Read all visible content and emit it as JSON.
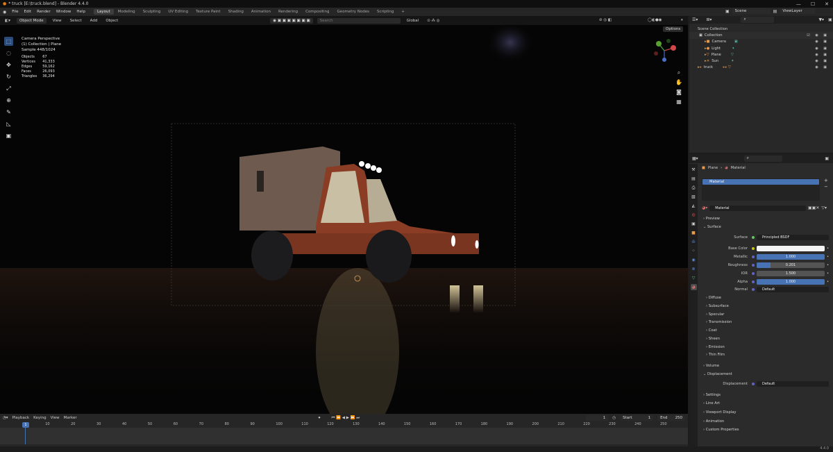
{
  "window": {
    "title": "* truck [E:\\truck.blend] - Blender 4.4.0",
    "controls": [
      "—",
      "☐",
      "✕"
    ]
  },
  "menu": [
    "File",
    "Edit",
    "Render",
    "Window",
    "Help"
  ],
  "workspaces": [
    "Layout",
    "Modeling",
    "Sculpting",
    "UV Editing",
    "Texture Paint",
    "Shading",
    "Animation",
    "Rendering",
    "Compositing",
    "Geometry Nodes",
    "Scripting",
    "+"
  ],
  "scene": {
    "scene_name": "Scene",
    "view_layer": "ViewLayer"
  },
  "viewport_header": {
    "mode": "Object Mode",
    "menus": [
      "View",
      "Select",
      "Add",
      "Object"
    ],
    "transform": "Global",
    "search_placeholder": "Search",
    "options": "Options"
  },
  "viewport_info": {
    "line1": "Camera Perspective",
    "line2": "(1) Collection | Plane",
    "line3": "Sample 448/1024",
    "stats": [
      {
        "label": "Objects",
        "value": "67"
      },
      {
        "label": "Vertices",
        "value": "41,333"
      },
      {
        "label": "Edges",
        "value": "59,162"
      },
      {
        "label": "Faces",
        "value": "26,093"
      },
      {
        "label": "Triangles",
        "value": "36,294"
      }
    ]
  },
  "outliner": {
    "search_placeholder": "",
    "items": [
      {
        "label": "Scene Collection",
        "indent": 0,
        "icon": "collection-icon"
      },
      {
        "label": "Collection",
        "indent": 1,
        "icon": "collection-icon"
      },
      {
        "label": "Camera",
        "indent": 2,
        "icon": "camera-icon"
      },
      {
        "label": "Light",
        "indent": 2,
        "icon": "light-icon"
      },
      {
        "label": "Plane",
        "indent": 2,
        "icon": "mesh-icon"
      },
      {
        "label": "Sun",
        "indent": 2,
        "icon": "sun-icon"
      },
      {
        "label": "truck",
        "indent": 1,
        "icon": "armature-icon"
      }
    ]
  },
  "properties": {
    "breadcrumb": [
      "Plane",
      "Material"
    ],
    "slot": "Material",
    "material_name": "Material",
    "sections": {
      "preview": "Preview",
      "surface": "Surface",
      "diffuse": "Diffuse",
      "subsurface": "Subsurface",
      "specular": "Specular",
      "transmission": "Transmission",
      "coat": "Coat",
      "sheen": "Sheen",
      "emission": "Emission",
      "thin_film": "Thin Film",
      "volume": "Volume",
      "displacement": "Displacement",
      "settings": "Settings",
      "line_art": "Line Art",
      "viewport_display": "Viewport Display",
      "animation": "Animation",
      "custom_properties": "Custom Properties"
    },
    "fields": {
      "surface_label": "Surface",
      "surface_value": "Principled BSDF",
      "base_color_label": "Base Color",
      "metallic_label": "Metallic",
      "metallic_value": "1.000",
      "metallic_fill": 1.0,
      "roughness_label": "Roughness",
      "roughness_value": "0.201",
      "roughness_fill": 0.201,
      "ior_label": "IOR",
      "ior_value": "1.500",
      "alpha_label": "Alpha",
      "alpha_value": "1.000",
      "alpha_fill": 1.0,
      "normal_label": "Normal",
      "normal_value": "Default",
      "displacement_label": "Displacement",
      "displacement_value": "Default"
    }
  },
  "timeline": {
    "menus": [
      "Playback",
      "Keying",
      "View",
      "Marker"
    ],
    "current_frame": "1",
    "start_label": "Start",
    "start": "1",
    "end_label": "End",
    "end": "250",
    "ticks": [
      "10",
      "20",
      "30",
      "40",
      "50",
      "60",
      "70",
      "80",
      "90",
      "100",
      "110",
      "120",
      "130",
      "140",
      "150",
      "160",
      "170",
      "180",
      "190",
      "200",
      "210",
      "220",
      "230",
      "240",
      "250"
    ]
  },
  "version": "4.4.0",
  "colors": {
    "accent_blue": "#4772b3",
    "viewport_bg": "#050505",
    "truck_body": "#8a3d24"
  }
}
